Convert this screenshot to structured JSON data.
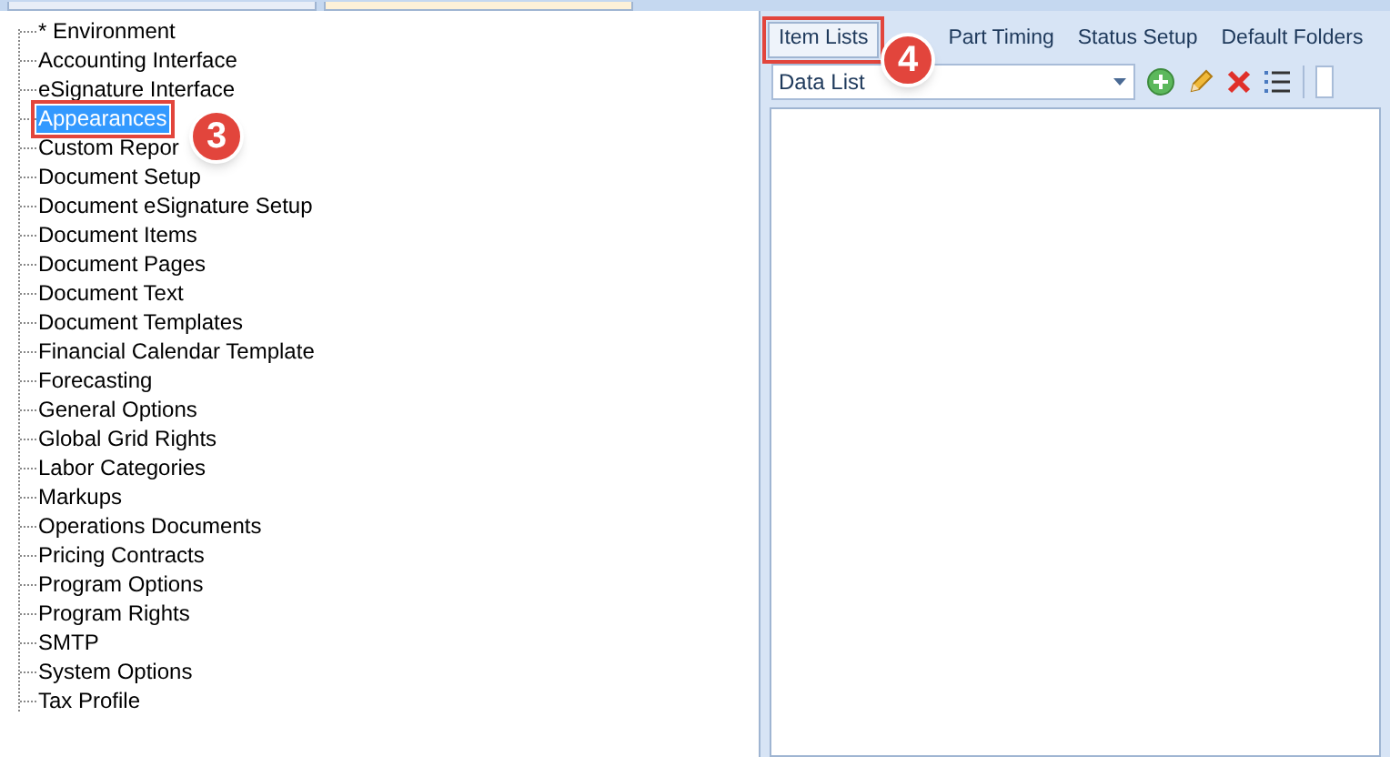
{
  "document_tabs": [
    {
      "selected": false
    },
    {
      "selected": true
    }
  ],
  "tree": {
    "items": [
      {
        "label": "* Environment",
        "selected": false
      },
      {
        "label": "Accounting Interface",
        "selected": false
      },
      {
        "label": "eSignature Interface",
        "selected": false
      },
      {
        "label": "Appearances",
        "selected": true,
        "callout": "3"
      },
      {
        "label": "Custom Repor",
        "selected": false
      },
      {
        "label": "Document Setup",
        "selected": false
      },
      {
        "label": "Document eSignature Setup",
        "selected": false
      },
      {
        "label": "Document Items",
        "selected": false
      },
      {
        "label": "Document Pages",
        "selected": false
      },
      {
        "label": "Document Text",
        "selected": false
      },
      {
        "label": "Document Templates",
        "selected": false
      },
      {
        "label": "Financial Calendar Template",
        "selected": false
      },
      {
        "label": "Forecasting",
        "selected": false
      },
      {
        "label": "General Options",
        "selected": false
      },
      {
        "label": "Global Grid Rights",
        "selected": false
      },
      {
        "label": "Labor Categories",
        "selected": false
      },
      {
        "label": "Markups",
        "selected": false
      },
      {
        "label": "Operations Documents",
        "selected": false
      },
      {
        "label": "Pricing Contracts",
        "selected": false
      },
      {
        "label": "Program Options",
        "selected": false
      },
      {
        "label": "Program Rights",
        "selected": false
      },
      {
        "label": "SMTP",
        "selected": false
      },
      {
        "label": "System Options",
        "selected": false
      },
      {
        "label": "Tax Profile",
        "selected": false
      }
    ]
  },
  "tabs": [
    {
      "label": "Item Lists",
      "selected": true,
      "callout": "4"
    },
    {
      "label": "Part Timing",
      "selected": false
    },
    {
      "label": "Status Setup",
      "selected": false
    },
    {
      "label": "Default Folders",
      "selected": false
    }
  ],
  "toolbar": {
    "dropdown_value": "Data List"
  }
}
